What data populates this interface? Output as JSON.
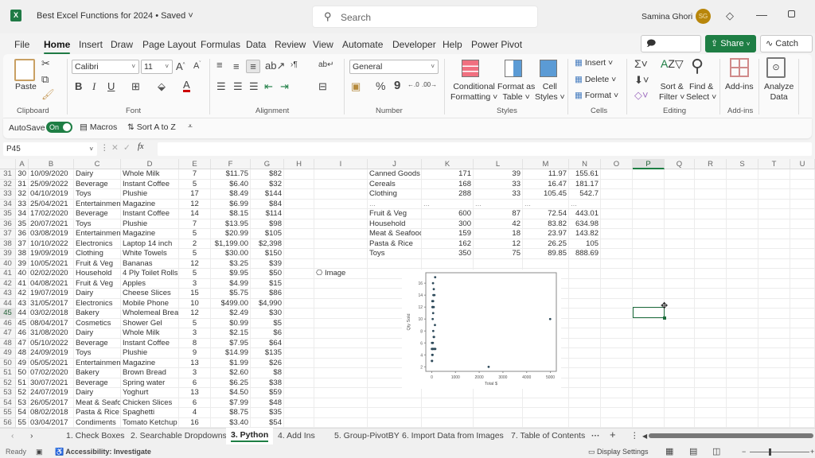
{
  "titlebar": {
    "app_icon": "excel-logo-icon",
    "app_letter": "X",
    "document_title": "Best Excel Functions for 2024 • Saved ˅",
    "search_placeholder": "Search",
    "user_name": "Samina Ghori",
    "user_initials": "SG",
    "colors": {
      "avatar": "#b8860b",
      "accent": "#1e7e44"
    }
  },
  "menu_tabs": [
    "File",
    "Home",
    "Insert",
    "Draw",
    "Page Layout",
    "Formulas",
    "Data",
    "Review",
    "View",
    "Automate",
    "Developer",
    "Help",
    "Power Pivot"
  ],
  "active_tab": "Home",
  "header_buttons": {
    "comments": "Comments",
    "share": "Share",
    "catch_up": "Catch up"
  },
  "ribbon": {
    "clipboard": {
      "label": "Clipboard",
      "paste": "Paste"
    },
    "font": {
      "label": "Font",
      "font_name": "Calibri",
      "font_size": "11",
      "bold": "B",
      "italic": "I",
      "underline": "U"
    },
    "alignment": {
      "label": "Alignment"
    },
    "number": {
      "label": "Number",
      "format": "General",
      "percent": "%",
      "comma": "9"
    },
    "styles": {
      "label": "Styles",
      "conditional_formatting": [
        "Conditional",
        "Formatting ˅"
      ],
      "format_as_table": [
        "Format as",
        "Table ˅"
      ],
      "cell_styles": [
        "Cell",
        "Styles ˅"
      ]
    },
    "cells": {
      "label": "Cells",
      "insert": "Insert ˅",
      "delete": "Delete ˅",
      "format": "Format ˅"
    },
    "editing": {
      "label": "Editing",
      "sort_filter": [
        "Sort &",
        "Filter ˅"
      ],
      "find_select": [
        "Find &",
        "Select ˅"
      ]
    },
    "addins": {
      "label": "Add-ins",
      "addins_button": "Add-ins"
    },
    "analyze": {
      "analyze_data": [
        "Analyze",
        "Data"
      ]
    }
  },
  "qat": {
    "autosave": "AutoSave",
    "autosave_state": "On",
    "macros": "Macros",
    "sort": "Sort A to Z"
  },
  "formula_bar": {
    "name_box": "P45",
    "fx": "fx",
    "formula": ""
  },
  "grid": {
    "columns": [
      "A",
      "B",
      "C",
      "D",
      "E",
      "F",
      "G",
      "H",
      "I",
      "J",
      "K",
      "L",
      "M",
      "N",
      "O",
      "P",
      "Q",
      "R",
      "S",
      "T",
      "U"
    ],
    "selected_column": "P",
    "selected_row": "45",
    "row_numbers": [
      "31",
      "32",
      "33",
      "34",
      "35",
      "36",
      "37",
      "38",
      "39",
      "40",
      "41",
      "42",
      "43",
      "44",
      "45",
      "46",
      "47",
      "48",
      "49",
      "50",
      "51",
      "52",
      "53",
      "54",
      "55",
      "56"
    ],
    "sales_rows": [
      [
        "30",
        "10/09/2020",
        "Dairy",
        "Whole Milk",
        "7",
        "$11.75",
        "$82"
      ],
      [
        "31",
        "25/09/2022",
        "Beverage",
        "Instant Coffee",
        "5",
        "$6.40",
        "$32"
      ],
      [
        "32",
        "04/10/2019",
        "Toys",
        "Plushie",
        "17",
        "$8.49",
        "$144"
      ],
      [
        "33",
        "25/04/2021",
        "Entertainment",
        "Magazine",
        "12",
        "$6.99",
        "$84"
      ],
      [
        "34",
        "17/02/2020",
        "Beverage",
        "Instant Coffee",
        "14",
        "$8.15",
        "$114"
      ],
      [
        "35",
        "20/07/2021",
        "Toys",
        "Plushie",
        "7",
        "$13.95",
        "$98"
      ],
      [
        "36",
        "03/08/2019",
        "Entertainment",
        "Magazine",
        "5",
        "$20.99",
        "$105"
      ],
      [
        "37",
        "10/10/2022",
        "Electronics",
        "Laptop 14 inch",
        "2",
        "$1,199.00",
        "$2,398"
      ],
      [
        "38",
        "19/09/2019",
        "Clothing",
        "White Towels",
        "5",
        "$30.00",
        "$150"
      ],
      [
        "39",
        "10/05/2021",
        "Fruit & Veg",
        "Bananas",
        "12",
        "$3.25",
        "$39"
      ],
      [
        "40",
        "02/02/2020",
        "Household",
        "4 Ply Toilet Rolls",
        "5",
        "$9.95",
        "$50"
      ],
      [
        "41",
        "04/08/2021",
        "Fruit & Veg",
        "Apples",
        "3",
        "$4.99",
        "$15"
      ],
      [
        "42",
        "19/07/2019",
        "Dairy",
        "Cheese Slices",
        "15",
        "$5.75",
        "$86"
      ],
      [
        "43",
        "31/05/2017",
        "Electronics",
        "Mobile Phone",
        "10",
        "$499.00",
        "$4,990"
      ],
      [
        "44",
        "03/02/2018",
        "Bakery",
        "Wholemeal Bread",
        "12",
        "$2.49",
        "$30"
      ],
      [
        "45",
        "08/04/2017",
        "Cosmetics",
        "Shower Gel",
        "5",
        "$0.99",
        "$5"
      ],
      [
        "46",
        "31/08/2020",
        "Dairy",
        "Whole Milk",
        "3",
        "$2.15",
        "$6"
      ],
      [
        "47",
        "05/10/2022",
        "Beverage",
        "Instant Coffee",
        "8",
        "$7.95",
        "$64"
      ],
      [
        "48",
        "24/09/2019",
        "Toys",
        "Plushie",
        "9",
        "$14.99",
        "$135"
      ],
      [
        "49",
        "05/05/2021",
        "Entertainment",
        "Magazine",
        "13",
        "$1.99",
        "$26"
      ],
      [
        "50",
        "07/02/2020",
        "Bakery",
        "Brown Bread",
        "3",
        "$2.60",
        "$8"
      ],
      [
        "51",
        "30/07/2021",
        "Beverage",
        "Spring water",
        "6",
        "$6.25",
        "$38"
      ],
      [
        "52",
        "24/07/2019",
        "Dairy",
        "Yoghurt",
        "13",
        "$4.50",
        "$59"
      ],
      [
        "53",
        "26/05/2017",
        "Meat & Seafood",
        "Chicken Slices",
        "6",
        "$7.99",
        "$48"
      ],
      [
        "54",
        "08/02/2018",
        "Pasta & Rice",
        "Spaghetti",
        "4",
        "$8.75",
        "$35"
      ],
      [
        "55",
        "03/04/2017",
        "Condiments",
        "Tomato Ketchup",
        "16",
        "$3.40",
        "$54"
      ]
    ],
    "summary_rows": [
      [
        "Canned Goods",
        "171",
        "39",
        "11.97",
        "155.61"
      ],
      [
        "Cereals",
        "168",
        "33",
        "16.47",
        "181.17"
      ],
      [
        "Clothing",
        "288",
        "33",
        "105.45",
        "542.7"
      ],
      [
        "...",
        "...",
        "...",
        "...",
        "..."
      ],
      [
        "Fruit & Veg",
        "600",
        "87",
        "72.54",
        "443.01"
      ],
      [
        "Household",
        "300",
        "42",
        "83.82",
        "634.98"
      ],
      [
        "Meat & Seafood",
        "159",
        "18",
        "23.97",
        "143.82"
      ],
      [
        "Pasta & Rice",
        "162",
        "12",
        "26.25",
        "105"
      ],
      [
        "Toys",
        "350",
        "75",
        "89.85",
        "888.69"
      ]
    ],
    "image_cell_label": "Image"
  },
  "chart_data": {
    "type": "scatter",
    "title": "",
    "xlabel": "Total $",
    "ylabel": "Qty Sold",
    "xlim": [
      -250,
      5250
    ],
    "ylim": [
      1.25,
      17.75
    ],
    "xticks": [
      0,
      1000,
      2000,
      3000,
      4000,
      5000
    ],
    "yticks": [
      2,
      4,
      6,
      8,
      10,
      12,
      14,
      16
    ],
    "grid": false,
    "points": [
      [
        82,
        7
      ],
      [
        32,
        5
      ],
      [
        144,
        17
      ],
      [
        84,
        12
      ],
      [
        114,
        14
      ],
      [
        98,
        7
      ],
      [
        105,
        5
      ],
      [
        2398,
        2
      ],
      [
        150,
        5
      ],
      [
        39,
        12
      ],
      [
        50,
        5
      ],
      [
        15,
        3
      ],
      [
        86,
        15
      ],
      [
        4990,
        10
      ],
      [
        30,
        12
      ],
      [
        5,
        5
      ],
      [
        6,
        3
      ],
      [
        64,
        8
      ],
      [
        135,
        9
      ],
      [
        26,
        13
      ],
      [
        8,
        3
      ],
      [
        38,
        6
      ],
      [
        59,
        13
      ],
      [
        48,
        6
      ],
      [
        35,
        4
      ],
      [
        54,
        16
      ],
      [
        70,
        14
      ],
      [
        60,
        11
      ],
      [
        40,
        10
      ],
      [
        20,
        4
      ],
      [
        10,
        6
      ]
    ]
  },
  "sheet_tabs": [
    "1. Check Boxes",
    "2. Searchable Dropdowns",
    "3. Python",
    "4. Add Ins",
    "5. Group-PivotBY",
    "6. Import Data from Images",
    "7. Table of Contents"
  ],
  "active_sheet": "3. Python",
  "status_bar": {
    "ready": "Ready",
    "accessibility": "Accessibility: Investigate",
    "display_settings": "Display Settings"
  }
}
